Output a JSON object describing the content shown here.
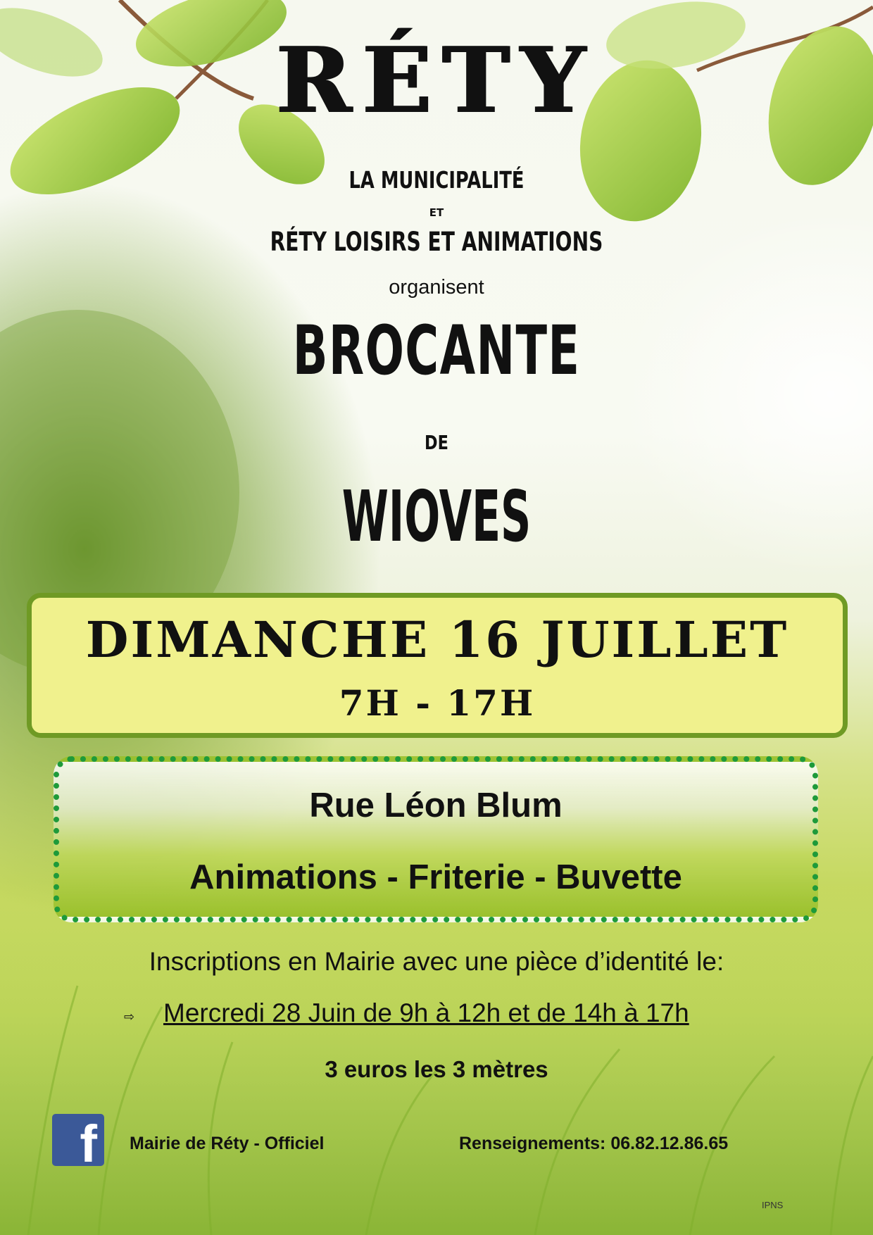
{
  "title": "RÉTY",
  "organizers": {
    "line1": "LA MUNICIPALITÉ",
    "conjunction": "ET",
    "line2": "RÉTY LOISIRS ET ANIMATIONS",
    "verb": "organisent"
  },
  "event": {
    "name": "BROCANTE",
    "preposition": "DE",
    "place_name": "WIOVES"
  },
  "schedule": {
    "date": "DIMANCHE 16 JUILLET",
    "hours": "7H - 17H"
  },
  "location": {
    "street": "Rue Léon Blum",
    "amenities": "Animations - Friterie - Buvette"
  },
  "registration": {
    "intro": "Inscriptions en Mairie avec une pièce d’identité le:",
    "arrow_symbol": "⇨",
    "slot": "Mercredi 28 Juin de 9h à 12h et de 14h à 17h",
    "price": "3 euros les 3 mètres"
  },
  "footer": {
    "facebook_page": "Mairie de Réty - Officiel",
    "contact": "Renseignements: 06.82.12.86.65",
    "ipns": "IPNS"
  },
  "icons": {
    "facebook": "facebook-icon",
    "facebook_glyph": "f"
  },
  "colors": {
    "date_box_fill": "#f0f18d",
    "date_box_border": "#6f9a24",
    "place_box_border": "#1e9a3a",
    "facebook_blue": "#3b5998"
  }
}
